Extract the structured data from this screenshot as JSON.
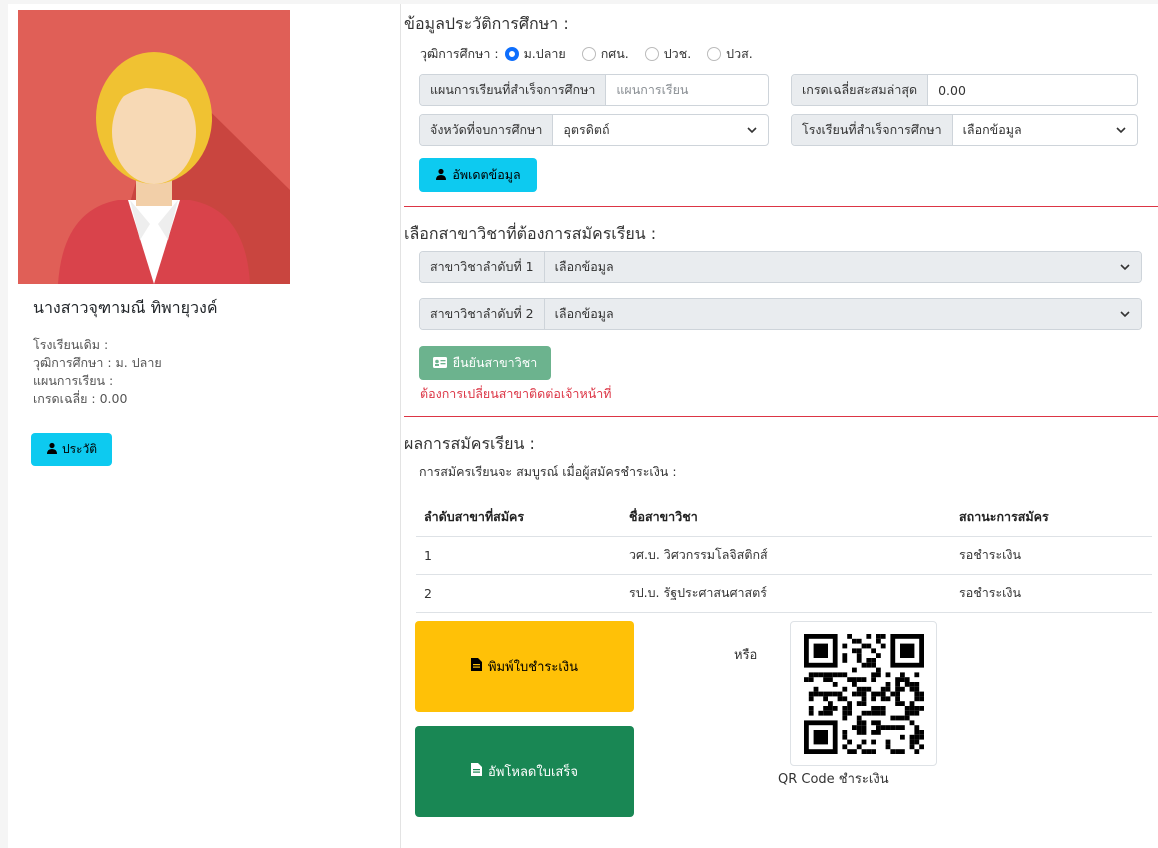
{
  "profile": {
    "name": "นางสาวจุฑามณี ทิพายุวงค์",
    "school_line": "โรงเรียนเดิม :",
    "education_line": "วุฒิการศึกษา : ม. ปลาย",
    "program_line": "แผนการเรียน :",
    "gpa_line": "เกรดเฉลี่ย : 0.00",
    "history_button": "ประวัติ"
  },
  "education": {
    "title": "ข้อมูลประวัติการศึกษา :",
    "level_label": "วุฒิการศึกษา :",
    "levels": [
      {
        "label": "ม.ปลาย",
        "selected": true
      },
      {
        "label": "กศน.",
        "selected": false
      },
      {
        "label": "ปวช.",
        "selected": false
      },
      {
        "label": "ปวส.",
        "selected": false
      }
    ],
    "program_label": "แผนการเรียนที่สำเร็จการศึกษา",
    "program_placeholder": "แผนการเรียน",
    "gpa_label": "เกรดเฉลี่ยสะสมล่าสุด",
    "gpa_value": "0.00",
    "province_label": "จังหวัดที่จบการศึกษา",
    "province_value": "อุตรดิตถ์",
    "school_label": "โรงเรียนที่สำเร็จการศึกษา",
    "school_value": "เลือกข้อมูล",
    "update_button": "อัพเดตข้อมูล"
  },
  "majors": {
    "title": "เลือกสาขาวิชาที่ต้องการสมัครเรียน :",
    "choice1_label": "สาขาวิชาลำดับที่ 1",
    "choice1_value": "เลือกข้อมูล",
    "choice2_label": "สาขาวิชาลำดับที่ 2",
    "choice2_value": "เลือกข้อมูล",
    "confirm_button": "ยืนยันสาขาวิชา",
    "warning": "ต้องการเปลี่ยนสาขาติดต่อเจ้าหน้าที่"
  },
  "results": {
    "title": "ผลการสมัครเรียน :",
    "subtitle": "การสมัครเรียนจะ สมบูรณ์ เมื่อผู้สมัครชำระเงิน :",
    "columns": [
      "ลำดับสาขาที่สมัคร",
      "ชื่อสาขาวิชา",
      "สถานะการสมัคร"
    ],
    "rows": [
      {
        "order": "1",
        "major": "วศ.บ. วิศวกรรมโลจิสติกส์",
        "status": "รอชำระเงิน"
      },
      {
        "order": "2",
        "major": "รป.บ. รัฐประศาสนศาสตร์",
        "status": "รอชำระเงิน"
      }
    ],
    "print_button": "พิมพ์ใบชำระเงิน",
    "upload_button": "อัพโหลดใบเสร็จ",
    "or_text": "หรือ",
    "qr_caption": "QR Code ชำระเงิน"
  },
  "colors": {
    "info": "#0dcaf0",
    "warning": "#ffc107",
    "success": "#198754",
    "danger": "#dc3545",
    "pending": "#f0ad4e"
  }
}
